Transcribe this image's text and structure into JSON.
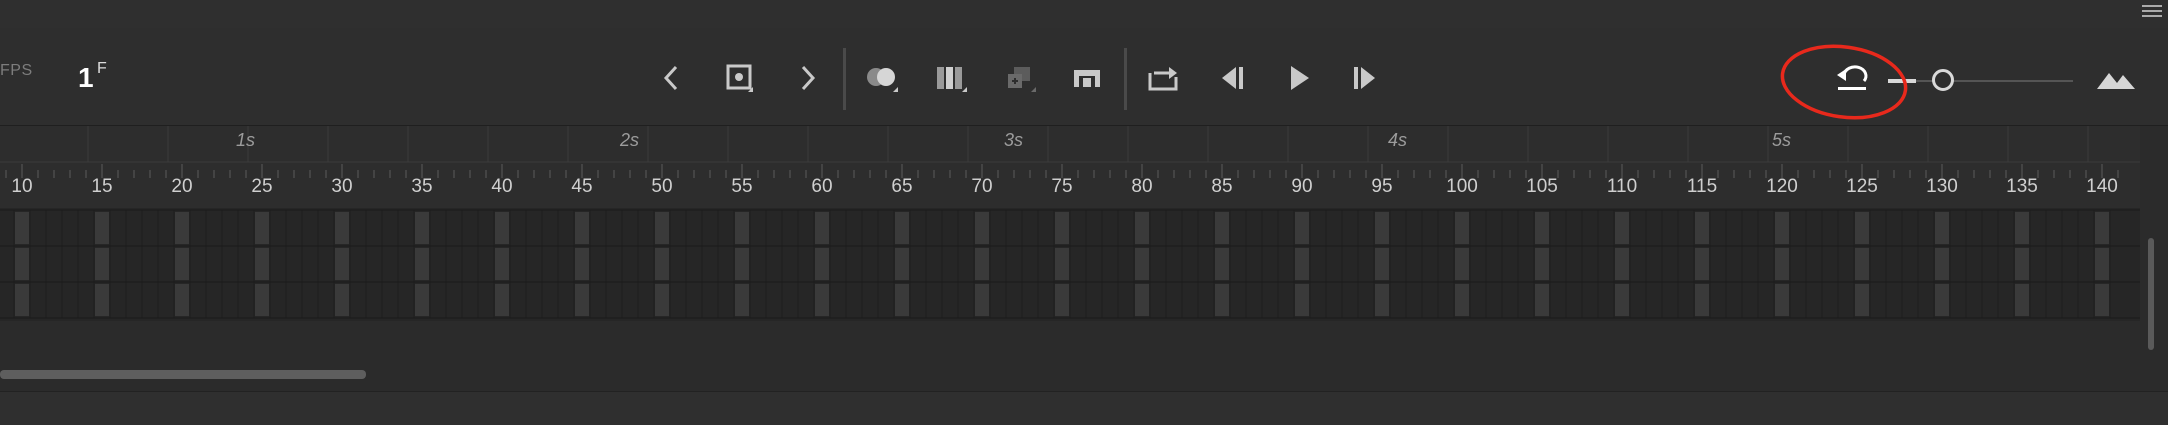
{
  "header": {
    "fps_label": "FPS",
    "current_frame": "1",
    "frame_unit": "F"
  },
  "toolbar": {
    "buttons": [
      {
        "name": "previous-keyframe-icon"
      },
      {
        "name": "insert-keyframe-icon"
      },
      {
        "name": "next-keyframe-icon"
      },
      {
        "name": "onion-skin-icon"
      },
      {
        "name": "edit-multiple-frames-icon"
      },
      {
        "name": "add-to-timeline-icon"
      },
      {
        "name": "center-frame-icon"
      },
      {
        "name": "loop-icon"
      },
      {
        "name": "step-back-icon"
      },
      {
        "name": "play-icon"
      },
      {
        "name": "step-forward-icon"
      },
      {
        "name": "reset-timeline-scale-icon"
      },
      {
        "name": "timeline-size-icon"
      }
    ]
  },
  "timeline_scale": {
    "level": 0.25
  },
  "ruler": {
    "second_labels": [
      "1s",
      "2s",
      "3s",
      "4s",
      "5s"
    ],
    "frame_labels": [
      "10",
      "15",
      "20",
      "25",
      "30",
      "35",
      "40",
      "45",
      "50",
      "55",
      "60",
      "65",
      "70",
      "75",
      "80",
      "85",
      "90",
      "95",
      "100",
      "105",
      "110",
      "115",
      "120",
      "125",
      "130",
      "135",
      "140"
    ]
  },
  "tracks": {
    "rows": 3
  },
  "colors": {
    "annotation": "#e8291c",
    "active_icon": "#ffffff",
    "icon": "#c9c9c9",
    "disabled_icon": "#6a6a6a"
  }
}
